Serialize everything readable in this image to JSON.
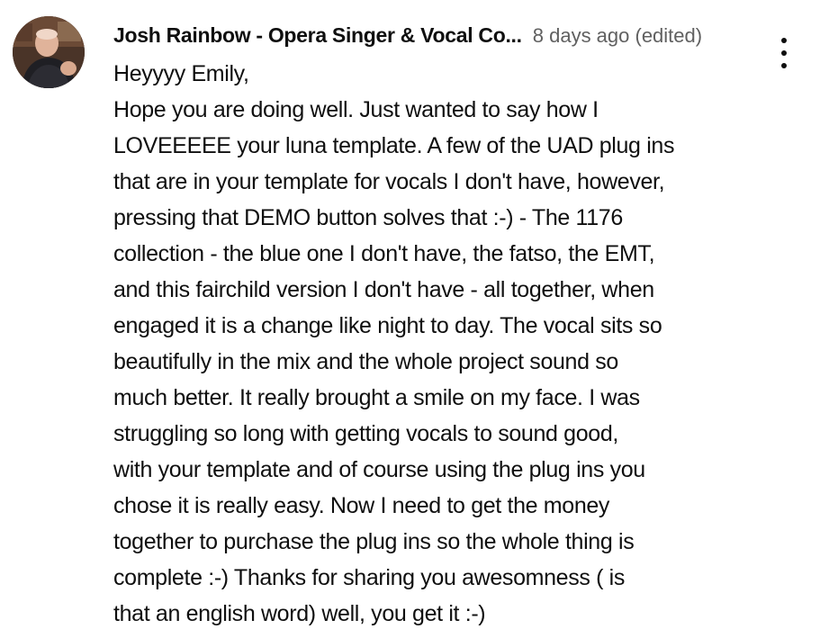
{
  "comment": {
    "author": "Josh Rainbow - Opera Singer & Vocal Co...",
    "timestamp": "8 days ago (edited)",
    "avatar_icon": "user-avatar-photo",
    "menu_icon": "more-vert-icon",
    "body_lines": [
      "Heyyyy Emily,",
      "Hope you are doing well. Just wanted to say how I",
      "LOVEEEEE your luna template. A few of the UAD plug ins",
      "that are in your template for vocals I don't have, however,",
      "pressing that DEMO button solves that :-) - The 1176",
      "collection - the blue one I don't have, the fatso, the EMT,",
      "and this fairchild version I don't have - all together, when",
      "engaged it is a change like night to day. The vocal sits so",
      "beautifully in the mix and the whole project sound so",
      "much better. It really brought a smile on my face. I was",
      "struggling so long with getting vocals to sound good,",
      "with your template and of course using the plug ins you",
      "chose it is really easy. Now I need to get the money",
      "together to purchase the plug ins so the whole thing is",
      "complete :-) Thanks for sharing you awesomness ( is",
      "that an english word) well, you get it :-)"
    ]
  }
}
